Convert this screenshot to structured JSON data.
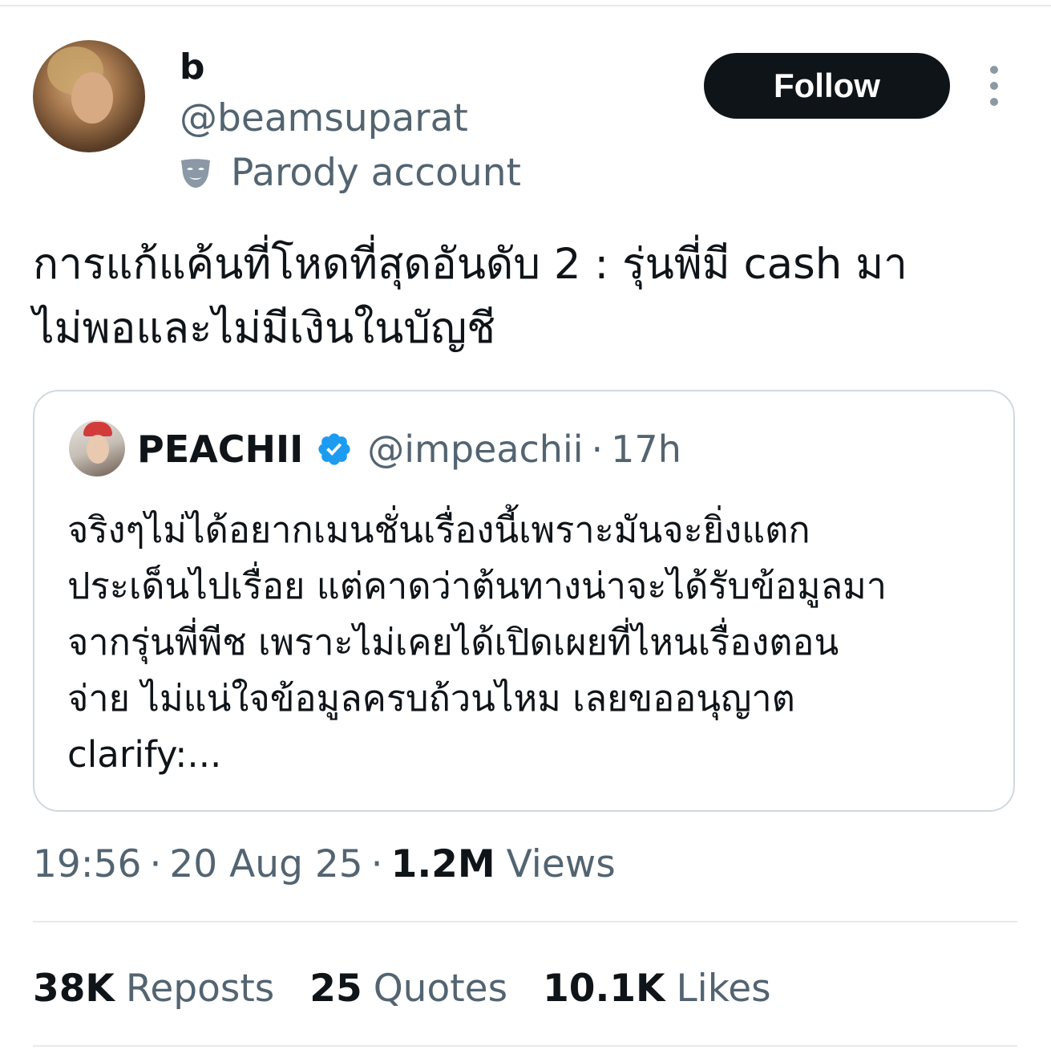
{
  "author": {
    "display_name": "b",
    "handle": "@beamsuparat",
    "parody_label": "Parody account",
    "avatar_icon": "avatar",
    "parody_icon": "theater-mask-icon"
  },
  "actions": {
    "follow_label": "Follow",
    "more_icon": "more-vertical-icon"
  },
  "tweet": {
    "text": "การแก้แค้นที่โหดที่สุดอันดับ 2 : รุ่นพี่มี cash มา\nไม่พอและไม่มีเงินในบัญชี"
  },
  "quote": {
    "display_name": "PEACHII",
    "verified_icon": "verified-badge-icon",
    "handle": "@impeachii",
    "separator": "·",
    "time": "17h",
    "text": "จริงๆไม่ได้อยากเมนชั่นเรื่องนี้เพราะมันจะยิ่งแตก\nประเด็นไปเรื่อย แต่คาดว่าต้นทางน่าจะได้รับข้อมูลมา\nจากรุ่นพี่พีช เพราะไม่เคยได้เปิดเผยที่ไหนเรื่องตอน\nจ่าย ไม่แน่ใจข้อมูลครบถ้วนไหม เลยขออนุญาต\nclarify:..."
  },
  "meta": {
    "time": "19:56",
    "separator": "·",
    "date": "20 Aug 25",
    "views_count": "1.2M",
    "views_label": "Views"
  },
  "stats": {
    "reposts_count": "38K",
    "reposts_label": "Reposts",
    "quotes_count": "25",
    "quotes_label": "Quotes",
    "likes_count": "10.1K",
    "likes_label": "Likes"
  },
  "colors": {
    "primary_text": "#0f1419",
    "secondary_text": "#536471",
    "border": "#cfd9de",
    "divider": "#e7e9ea",
    "verified_blue": "#1d9bf0"
  }
}
